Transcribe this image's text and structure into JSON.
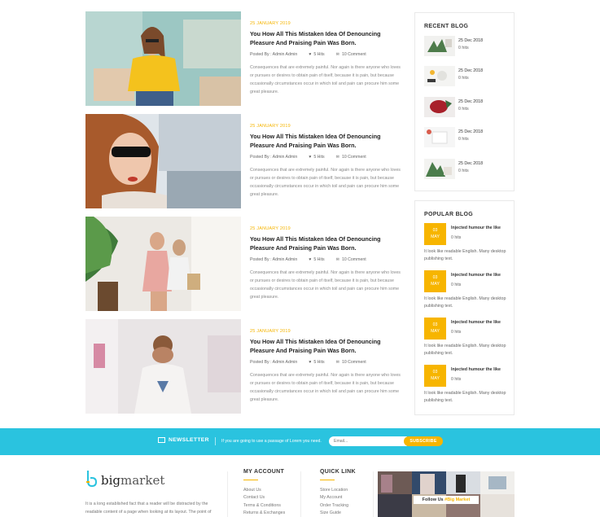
{
  "posts": [
    {
      "date": "25 JANUARY 2019",
      "title": "You How All This Mistaken Idea Of Denouncing Pleasure And Praising Pain Was Born.",
      "author": "Posted By : Admin Admin",
      "hits": "5 Hits",
      "comments": "10 Comment",
      "excerpt": "Consequences that are extremely painful. Nor again is there anyone who loves or pursues or desires to obtain pain of itself, because it is pain, but because occasionally circumstances occur in which toil and pain can procure him some great pleasure."
    },
    {
      "date": "25 JANUARY 2019",
      "title": "You How All This Mistaken Idea Of Denouncing Pleasure And Praising Pain Was Born.",
      "author": "Posted By : Admin Admin",
      "hits": "5 Hits",
      "comments": "10 Comment",
      "excerpt": "Consequences that are extremely painful. Nor again is there anyone who loves or pursues or desires to obtain pain of itself, because it is pain, but because occasionally circumstances occur in which toil and pain can procure him some great pleasure."
    },
    {
      "date": "25 JANUARY 2019",
      "title": "You How All This Mistaken Idea Of Denouncing Pleasure And Praising Pain Was Born.",
      "author": "Posted By : Admin Admin",
      "hits": "5 Hits",
      "comments": "10 Comment",
      "excerpt": "Consequences that are extremely painful. Nor again is there anyone who loves or pursues or desires to obtain pain of itself, because it is pain, but because occasionally circumstances occur in which toil and pain can procure him some great pleasure."
    },
    {
      "date": "25 JANUARY 2019",
      "title": "You How All This Mistaken Idea Of Denouncing Pleasure And Praising Pain Was Born.",
      "author": "Posted By : Admin Admin",
      "hits": "5 Hits",
      "comments": "10 Comment",
      "excerpt": "Consequences that are extremely painful. Nor again is there anyone who loves or pursues or desires to obtain pain of itself, because it is pain, but because occasionally circumstances occur in which toil and pain can procure him some great pleasure."
    }
  ],
  "recent_blog": {
    "title": "RECENT BLOG",
    "items": [
      {
        "date": "25 Dec 2018",
        "hits": "0 hits"
      },
      {
        "date": "25 Dec 2018",
        "hits": "0 hits"
      },
      {
        "date": "25 Dec 2018",
        "hits": "0 hits"
      },
      {
        "date": "25 Dec 2018",
        "hits": "0 hits"
      },
      {
        "date": "25 Dec 2018",
        "hits": "0 hits"
      }
    ]
  },
  "popular_blog": {
    "title": "POPULAR BLOG",
    "items": [
      {
        "day": "03",
        "month": "MAY",
        "heading": "Injected humour the like",
        "hits": "0 hits",
        "desc": "It look like readable English. Many desktop publishing text."
      },
      {
        "day": "03",
        "month": "MAY",
        "heading": "Injected humour the like",
        "hits": "0 hits",
        "desc": "It look like readable English. Many desktop publishing text."
      },
      {
        "day": "03",
        "month": "MAY",
        "heading": "Injected humour the like",
        "hits": "0 hits",
        "desc": "It look like readable English. Many desktop publishing text."
      },
      {
        "day": "03",
        "month": "MAY",
        "heading": "Injected humour the like",
        "hits": "0 hits",
        "desc": "It look like readable English. Many desktop publishing text."
      }
    ]
  },
  "newsletter": {
    "title": "NEWSLETTER",
    "text": "If you are going to use a passage of Lorem you need.",
    "placeholder": "Email...",
    "button": "SUBSCRIBE"
  },
  "footer": {
    "logo_bold": "big",
    "logo_rest": "market",
    "about": "It is a long established fact that a reader will be distracted by the readable content of a page when looking at its layout. The point of",
    "my_account": {
      "title": "MY ACCOUNT",
      "links": [
        "About Us",
        "Contact Us",
        "Terms & Conditions",
        "Returns & Exchanges"
      ]
    },
    "quick_link": {
      "title": "QUICK LINK",
      "links": [
        "Store Location",
        "My Account",
        "Order Tracking",
        "Size Guide"
      ]
    },
    "instagram": {
      "label": "Follow Us",
      "handle": "#Big Market"
    }
  },
  "colors": {
    "accent": "#f7b500",
    "newsletter_bg": "#2ac3df"
  }
}
